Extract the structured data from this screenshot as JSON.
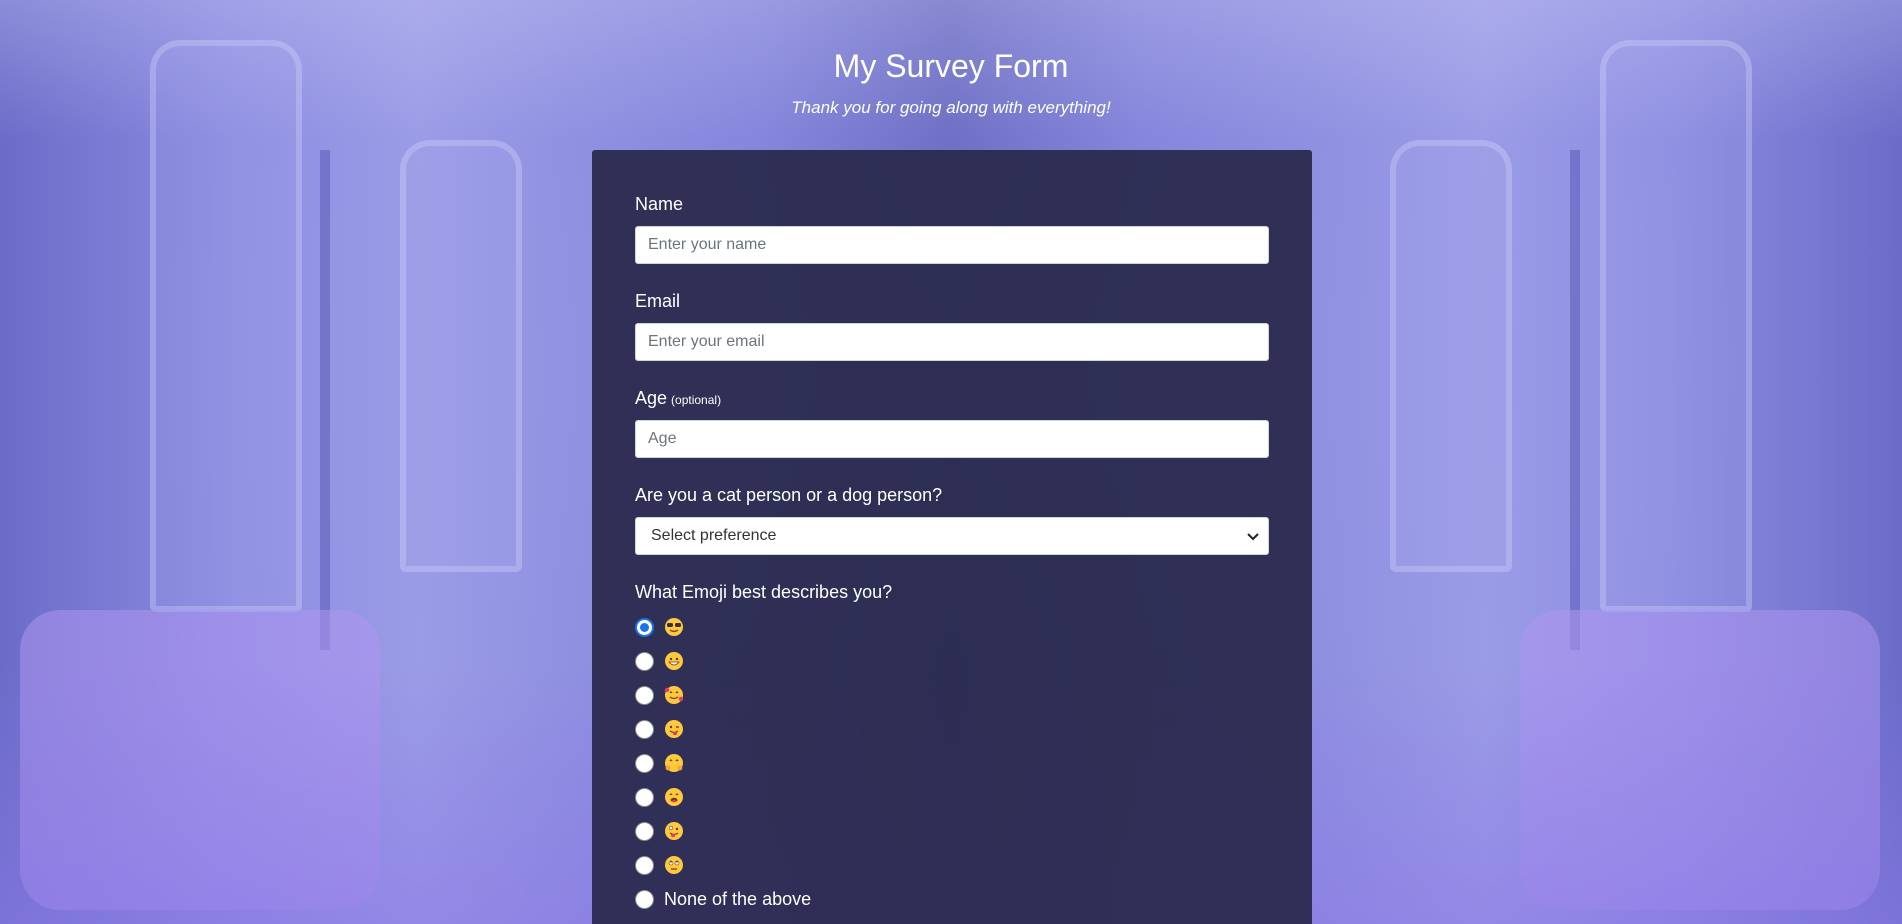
{
  "header": {
    "title": "My Survey Form",
    "subtitle": "Thank you for going along with everything!"
  },
  "form": {
    "name": {
      "label": "Name",
      "value": "",
      "placeholder": "Enter your name"
    },
    "email": {
      "label": "Email",
      "value": "",
      "placeholder": "Enter your email"
    },
    "age": {
      "label": "Age",
      "hint": "(optional)",
      "value": "",
      "placeholder": "Age"
    },
    "preference": {
      "label": "Are you a cat person or a dog person?",
      "selected": "Select preference"
    },
    "emoji_question": {
      "label": "What Emoji best describes you?",
      "options": [
        {
          "icon": "sunglasses-face-emoji",
          "checked": true
        },
        {
          "icon": "grinning-face-emoji",
          "checked": false
        },
        {
          "icon": "smiling-face-with-hearts-emoji",
          "checked": false
        },
        {
          "icon": "winking-tongue-face-emoji",
          "checked": false
        },
        {
          "icon": "hugging-face-emoji",
          "checked": false
        },
        {
          "icon": "drooling-face-emoji",
          "checked": false
        },
        {
          "icon": "zany-face-emoji",
          "checked": false
        },
        {
          "icon": "eye-roll-face-emoji",
          "checked": false
        }
      ],
      "none_label": "None of the above"
    }
  },
  "colors": {
    "card": "#28284b",
    "radio_checked": "#1a73e8",
    "emoji_face": "#ffc83d"
  }
}
